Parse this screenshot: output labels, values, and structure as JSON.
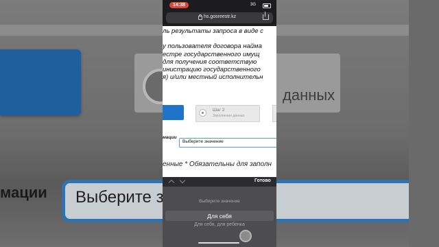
{
  "status_bar": {
    "time": "14:38",
    "network": "3G"
  },
  "browser": {
    "url": "hs.gosreestr.kz"
  },
  "page": {
    "text_lines": [
      "ль результаты запроса в виде с",
      "",
      "у пользователя договора найма",
      "естре государственного имущ",
      "для получения соответствую",
      "инистрацию государственного",
      "я) и/или местный исполнительн"
    ],
    "step2": {
      "title": "Шаг 2",
      "subtitle": "Заполнение данных"
    },
    "field_label": "мации",
    "select_value": "Выберите значение",
    "required_note": "енные * Обязательны для заполн"
  },
  "background": {
    "step_text": "данных",
    "field_label": "мации",
    "field_value": "Выберите з"
  },
  "picker": {
    "done_label": "Готово",
    "options": [
      "Выберите значение",
      "Для себя",
      "Для себя, для ребенка"
    ],
    "selected_index": 1
  },
  "colors": {
    "accent_blue": "#1f74c9",
    "select_border": "#5b9bd5",
    "time_pill": "#e0453a"
  }
}
